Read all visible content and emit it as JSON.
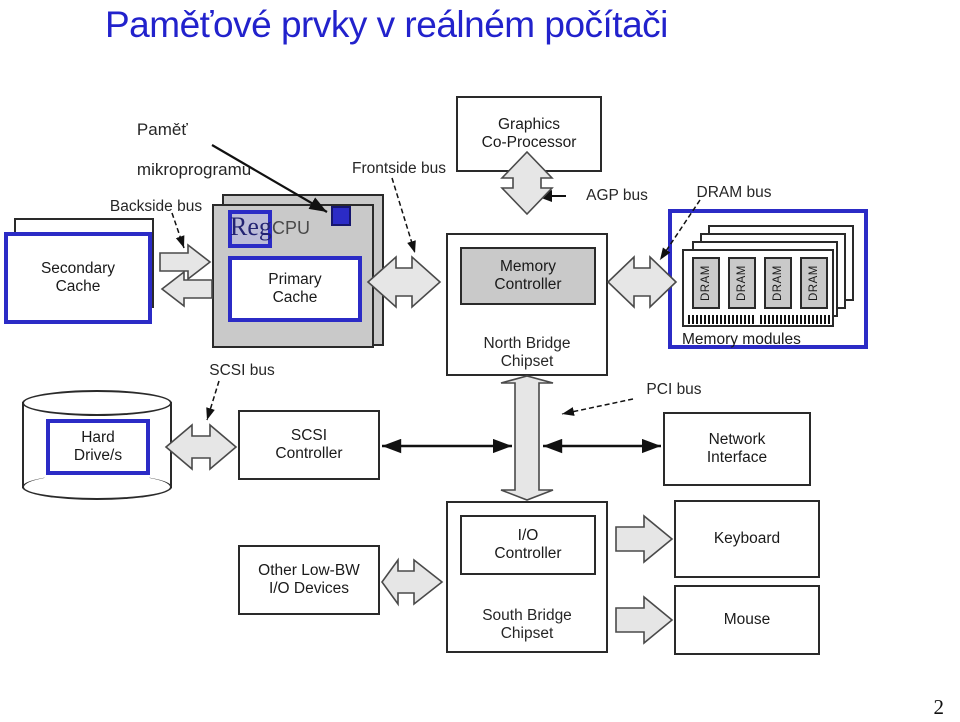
{
  "slide": {
    "title": "Paměťové prvky v reálném počítači",
    "page_number": "2",
    "title_color": "#2222cc",
    "accent_color": "#2b2bc6"
  },
  "annotation": {
    "line1": "Paměť",
    "line2": "mikroprogramu"
  },
  "bus_labels": {
    "backside": "Backside bus",
    "frontside": "Frontside bus",
    "agp": "AGP bus",
    "dram": "DRAM bus",
    "scsi": "SCSI bus",
    "pci": "PCI bus"
  },
  "blocks": {
    "secondary_cache": "Secondary\nCache",
    "cpu_reg": "Reg",
    "cpu": "CPU",
    "primary_cache": "Primary\nCache",
    "graphics": "Graphics\nCo-Processor",
    "memory_controller": "Memory\nController",
    "north_bridge": "North Bridge\nChipset",
    "memory_modules": "Memory modules",
    "dram_chip": "DRAM",
    "hard_drive": "Hard\nDrive/s",
    "scsi_controller": "SCSI\nController",
    "network_interface": "Network\nInterface",
    "other_io": "Other Low-BW\nI/O Devices",
    "io_controller": "I/O\nController",
    "south_bridge": "South Bridge\nChipset",
    "keyboard": "Keyboard",
    "mouse": "Mouse"
  },
  "dram_chips": [
    "DRAM",
    "DRAM",
    "DRAM",
    "DRAM"
  ]
}
